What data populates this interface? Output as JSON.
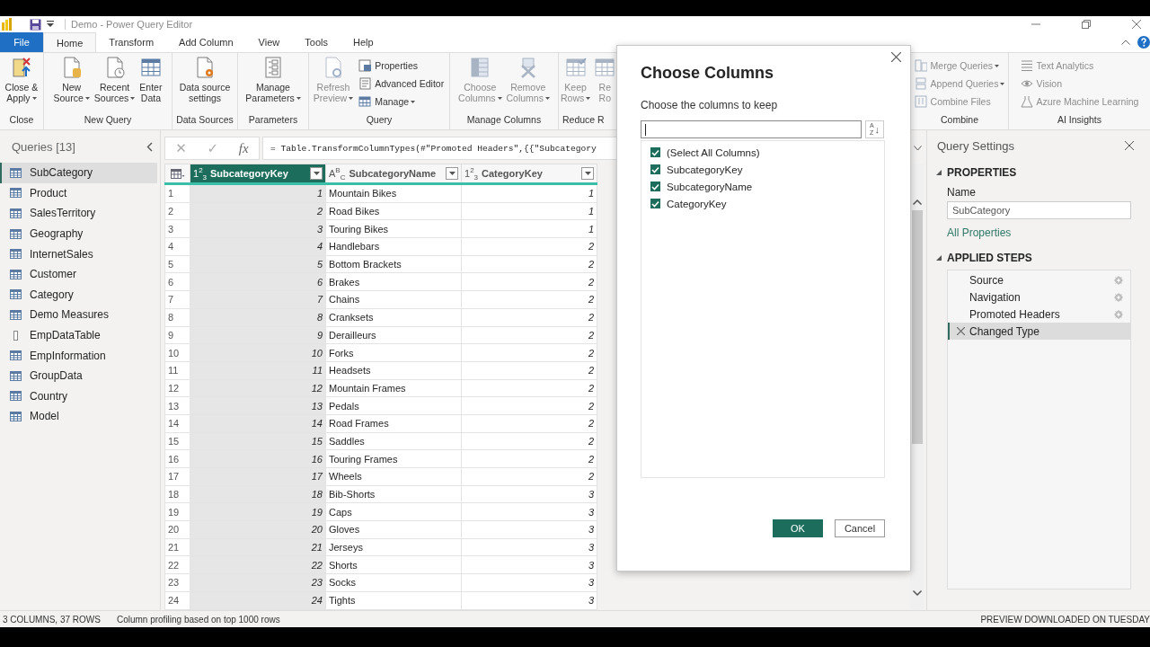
{
  "window": {
    "title": "Demo - Power Query Editor"
  },
  "menu_tabs": [
    {
      "label": "File",
      "kind": "file",
      "selected": false
    },
    {
      "label": "Home",
      "kind": "tab",
      "selected": true
    },
    {
      "label": "Transform",
      "kind": "tab",
      "selected": false
    },
    {
      "label": "Add Column",
      "kind": "tab",
      "selected": false
    },
    {
      "label": "View",
      "kind": "tab",
      "selected": false
    },
    {
      "label": "Tools",
      "kind": "tab",
      "selected": false
    },
    {
      "label": "Help",
      "kind": "tab",
      "selected": false
    }
  ],
  "ribbon": {
    "groups": [
      {
        "label": "Close",
        "buttons": [
          {
            "lines": [
              "Close &",
              "Apply"
            ],
            "kind": "large",
            "dropdown": true,
            "disabled": false
          }
        ]
      },
      {
        "label": "New Query",
        "buttons": [
          {
            "lines": [
              "New",
              "Source"
            ],
            "kind": "large",
            "dropdown": true,
            "disabled": false
          },
          {
            "lines": [
              "Recent",
              "Sources"
            ],
            "kind": "large",
            "dropdown": true,
            "disabled": false
          },
          {
            "lines": [
              "Enter",
              "Data"
            ],
            "kind": "large",
            "dropdown": false,
            "disabled": false
          }
        ]
      },
      {
        "label": "Data Sources",
        "buttons": [
          {
            "lines": [
              "Data source",
              "settings"
            ],
            "kind": "large",
            "dropdown": false,
            "disabled": false
          }
        ]
      },
      {
        "label": "Parameters",
        "buttons": [
          {
            "lines": [
              "Manage",
              "Parameters"
            ],
            "kind": "large",
            "dropdown": true,
            "disabled": false
          }
        ]
      },
      {
        "label": "Query",
        "buttons": [
          {
            "lines": [
              "Refresh",
              "Preview"
            ],
            "kind": "large",
            "dropdown": true,
            "disabled": true
          },
          {
            "lines": [
              "Properties"
            ],
            "kind": "small",
            "dropdown": false,
            "disabled": false
          },
          {
            "lines": [
              "Advanced Editor"
            ],
            "kind": "small",
            "dropdown": false,
            "disabled": false
          },
          {
            "lines": [
              "Manage"
            ],
            "kind": "small",
            "dropdown": true,
            "disabled": false
          }
        ]
      },
      {
        "label": "Manage Columns",
        "buttons": [
          {
            "lines": [
              "Choose",
              "Columns"
            ],
            "kind": "large",
            "dropdown": true,
            "disabled": true
          },
          {
            "lines": [
              "Remove",
              "Columns"
            ],
            "kind": "large",
            "dropdown": true,
            "disabled": true
          }
        ]
      },
      {
        "label": "Reduce R",
        "buttons": [
          {
            "lines": [
              "Keep",
              "Rows"
            ],
            "kind": "large",
            "dropdown": true,
            "disabled": true
          },
          {
            "lines": [
              "Re",
              "Ro"
            ],
            "kind": "large",
            "dropdown": false,
            "disabled": true
          }
        ]
      },
      {
        "label": "Combine",
        "buttons": [
          {
            "lines": [
              "Merge Queries"
            ],
            "kind": "small",
            "dropdown": true,
            "disabled": true
          },
          {
            "lines": [
              "Append Queries"
            ],
            "kind": "small",
            "dropdown": true,
            "disabled": true
          },
          {
            "lines": [
              "Combine Files"
            ],
            "kind": "small",
            "dropdown": false,
            "disabled": true
          }
        ]
      },
      {
        "label": "AI Insights",
        "buttons": [
          {
            "lines": [
              "Text Analytics"
            ],
            "kind": "small",
            "dropdown": false,
            "disabled": true
          },
          {
            "lines": [
              "Vision"
            ],
            "kind": "small",
            "dropdown": false,
            "disabled": true
          },
          {
            "lines": [
              "Azure Machine Learning"
            ],
            "kind": "small",
            "dropdown": false,
            "disabled": true
          }
        ]
      }
    ]
  },
  "queries": {
    "title": "Queries [13]",
    "items": [
      {
        "name": "SubCategory",
        "kind": "table",
        "selected": true
      },
      {
        "name": "Product",
        "kind": "table",
        "selected": false
      },
      {
        "name": "SalesTerritory",
        "kind": "table",
        "selected": false
      },
      {
        "name": "Geography",
        "kind": "table",
        "selected": false
      },
      {
        "name": "InternetSales",
        "kind": "table",
        "selected": false
      },
      {
        "name": "Customer",
        "kind": "table",
        "selected": false
      },
      {
        "name": "Category",
        "kind": "table",
        "selected": false
      },
      {
        "name": "Demo Measures",
        "kind": "table",
        "selected": false
      },
      {
        "name": "EmpDataTable",
        "kind": "column",
        "selected": false
      },
      {
        "name": "EmpInformation",
        "kind": "table",
        "selected": false
      },
      {
        "name": "GroupData",
        "kind": "table",
        "selected": false
      },
      {
        "name": "Country",
        "kind": "table",
        "selected": false
      },
      {
        "name": "Model",
        "kind": "table",
        "selected": false
      }
    ]
  },
  "formula_bar": {
    "buttons": [
      "✕",
      "✓",
      "fx"
    ],
    "formula": "= Table.TransformColumnTypes(#\"Promoted Headers\",{{\"Subcategory"
  },
  "table": {
    "columns": [
      {
        "name": "SubcategoryKey",
        "type_badge": "1$^{2}$$_{3}$",
        "kind": "number",
        "selected": true
      },
      {
        "name": "SubcategoryName",
        "type_badge": "A$^{B}$$_{C}$",
        "kind": "text",
        "selected": false
      },
      {
        "name": "CategoryKey",
        "type_badge": "1$^{2}$$_{3}$",
        "kind": "number",
        "selected": false
      }
    ],
    "rows": [
      {
        "number": "1",
        "cells": [
          "1",
          "Mountain Bikes",
          "1"
        ]
      },
      {
        "number": "2",
        "cells": [
          "2",
          "Road Bikes",
          "1"
        ]
      },
      {
        "number": "3",
        "cells": [
          "3",
          "Touring Bikes",
          "1"
        ]
      },
      {
        "number": "4",
        "cells": [
          "4",
          "Handlebars",
          "2"
        ]
      },
      {
        "number": "5",
        "cells": [
          "5",
          "Bottom Brackets",
          "2"
        ]
      },
      {
        "number": "6",
        "cells": [
          "6",
          "Brakes",
          "2"
        ]
      },
      {
        "number": "7",
        "cells": [
          "7",
          "Chains",
          "2"
        ]
      },
      {
        "number": "8",
        "cells": [
          "8",
          "Cranksets",
          "2"
        ]
      },
      {
        "number": "9",
        "cells": [
          "9",
          "Derailleurs",
          "2"
        ]
      },
      {
        "number": "10",
        "cells": [
          "10",
          "Forks",
          "2"
        ]
      },
      {
        "number": "11",
        "cells": [
          "11",
          "Headsets",
          "2"
        ]
      },
      {
        "number": "12",
        "cells": [
          "12",
          "Mountain Frames",
          "2"
        ]
      },
      {
        "number": "13",
        "cells": [
          "13",
          "Pedals",
          "2"
        ]
      },
      {
        "number": "14",
        "cells": [
          "14",
          "Road Frames",
          "2"
        ]
      },
      {
        "number": "15",
        "cells": [
          "15",
          "Saddles",
          "2"
        ]
      },
      {
        "number": "16",
        "cells": [
          "16",
          "Touring Frames",
          "2"
        ]
      },
      {
        "number": "17",
        "cells": [
          "17",
          "Wheels",
          "2"
        ]
      },
      {
        "number": "18",
        "cells": [
          "18",
          "Bib-Shorts",
          "3"
        ]
      },
      {
        "number": "19",
        "cells": [
          "19",
          "Caps",
          "3"
        ]
      },
      {
        "number": "20",
        "cells": [
          "20",
          "Gloves",
          "3"
        ]
      },
      {
        "number": "21",
        "cells": [
          "21",
          "Jerseys",
          "3"
        ]
      },
      {
        "number": "22",
        "cells": [
          "22",
          "Shorts",
          "3"
        ]
      },
      {
        "number": "23",
        "cells": [
          "23",
          "Socks",
          "3"
        ]
      },
      {
        "number": "24",
        "cells": [
          "24",
          "Tights",
          "3"
        ]
      }
    ]
  },
  "query_settings": {
    "title": "Query Settings",
    "properties_heading": "PROPERTIES",
    "name_label": "Name",
    "name_value": "SubCategory",
    "all_properties": "All Properties",
    "steps_heading": "APPLIED STEPS",
    "steps": [
      {
        "name": "Source",
        "settings": true,
        "selected": false
      },
      {
        "name": "Navigation",
        "settings": true,
        "selected": false
      },
      {
        "name": "Promoted Headers",
        "settings": true,
        "selected": false
      },
      {
        "name": "Changed Type",
        "settings": false,
        "selected": true
      }
    ]
  },
  "dialog": {
    "title": "Choose Columns",
    "subtitle": "Choose the columns to keep",
    "sort_button": {
      "letters": [
        "A",
        "Z"
      ],
      "arrow": "↓"
    },
    "items": [
      {
        "label": "(Select All Columns)",
        "checked": true
      },
      {
        "label": "SubcategoryKey",
        "checked": true
      },
      {
        "label": "SubcategoryName",
        "checked": true
      },
      {
        "label": "CategoryKey",
        "checked": true
      }
    ],
    "ok": "OK",
    "cancel": "Cancel"
  },
  "status_bar": {
    "left": [
      "3 COLUMNS, 37 ROWS",
      "Column profiling based on top 1000 rows"
    ],
    "right": "PREVIEW DOWNLOADED ON TUESDAY"
  }
}
